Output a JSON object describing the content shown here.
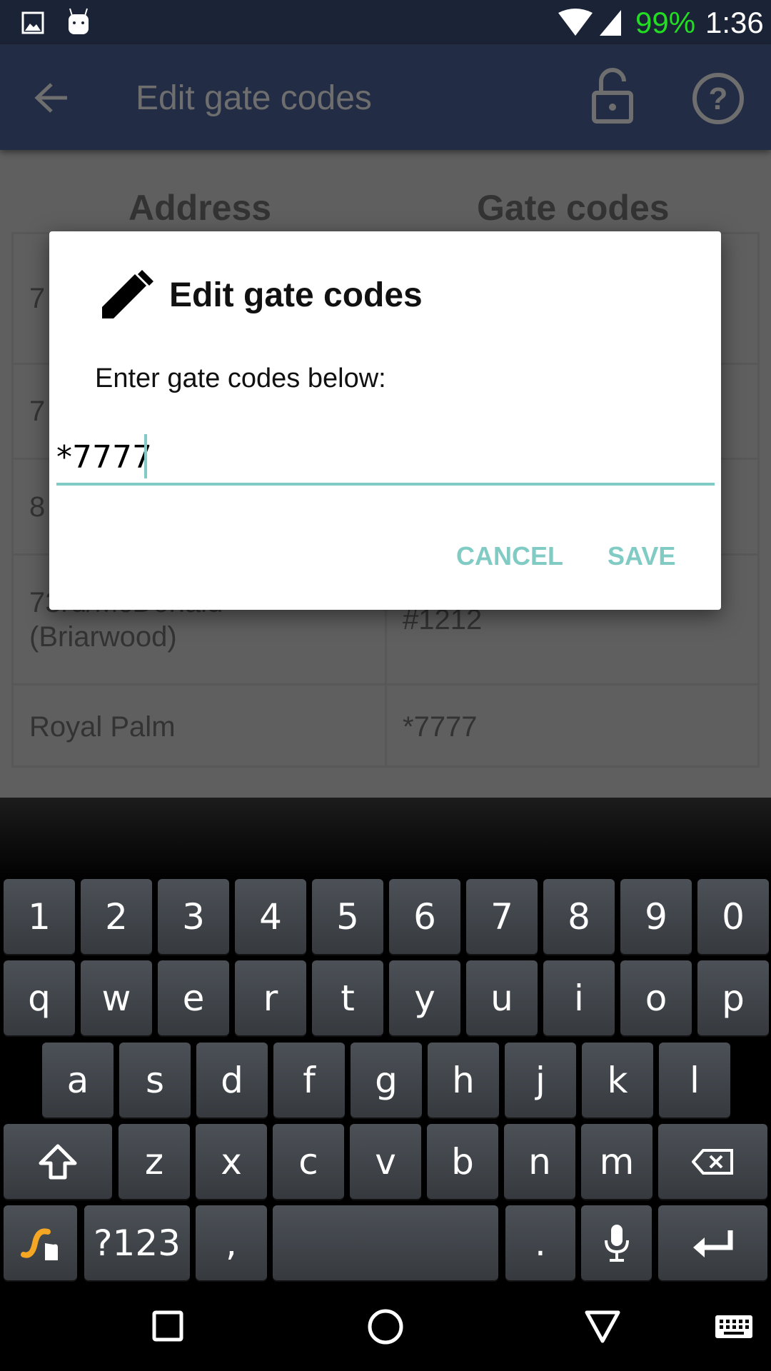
{
  "status": {
    "battery": "99%",
    "time": "1:36",
    "battery_color": "#22dd22"
  },
  "appbar": {
    "title": "Edit gate codes",
    "bg": "#222c44"
  },
  "table": {
    "headers": [
      "Address",
      "Gate codes"
    ],
    "rows": [
      {
        "address": "7",
        "code": ""
      },
      {
        "address": "7",
        "code": ""
      },
      {
        "address": "8",
        "code": ""
      },
      {
        "address": "73rd/McDonald (Briarwood)",
        "code": "#1212"
      },
      {
        "address": "Royal Palm",
        "code": "*7777"
      }
    ]
  },
  "dialog": {
    "title": "Edit gate codes",
    "message": "Enter gate codes below:",
    "input_value": "*7777",
    "cancel": "CANCEL",
    "save": "SAVE",
    "accent": "#80cbc4"
  },
  "keyboard": {
    "row1": [
      "1",
      "2",
      "3",
      "4",
      "5",
      "6",
      "7",
      "8",
      "9",
      "0"
    ],
    "row2": [
      "q",
      "w",
      "e",
      "r",
      "t",
      "y",
      "u",
      "i",
      "o",
      "p"
    ],
    "row3": [
      "a",
      "s",
      "d",
      "f",
      "g",
      "h",
      "j",
      "k",
      "l"
    ],
    "row4": [
      "z",
      "x",
      "c",
      "v",
      "b",
      "n",
      "m"
    ],
    "symbols": "?123",
    "comma": ",",
    "period": "."
  }
}
